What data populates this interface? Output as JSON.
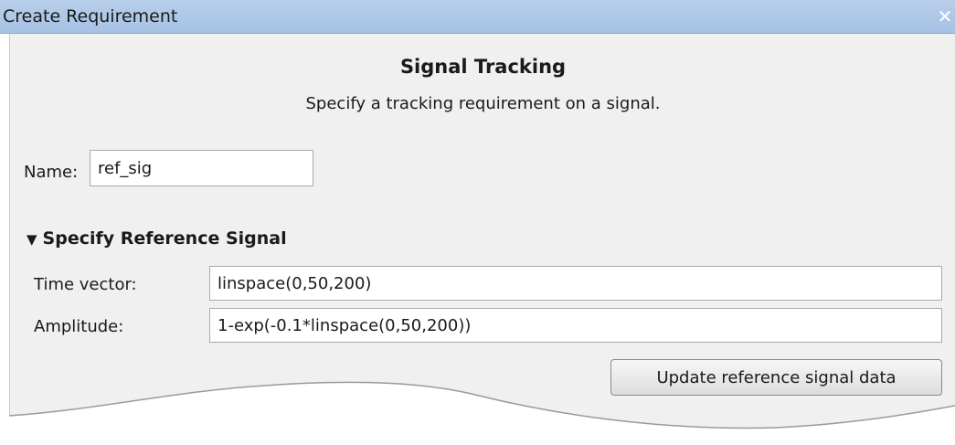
{
  "window": {
    "title": "Create Requirement",
    "close_glyph": "✕"
  },
  "header": {
    "title": "Signal Tracking",
    "description": "Specify a tracking requirement on a signal."
  },
  "name_field": {
    "label": "Name:",
    "value": "ref_sig"
  },
  "reference_section": {
    "arrow_icon": "▼",
    "title": "Specify Reference Signal",
    "time_vector_label": "Time vector:",
    "time_vector_value": "linspace(0,50,200)",
    "amplitude_label": "Amplitude:",
    "amplitude_value": "1-exp(-0.1*linspace(0,50,200))",
    "update_button_label": "Update reference signal data"
  }
}
